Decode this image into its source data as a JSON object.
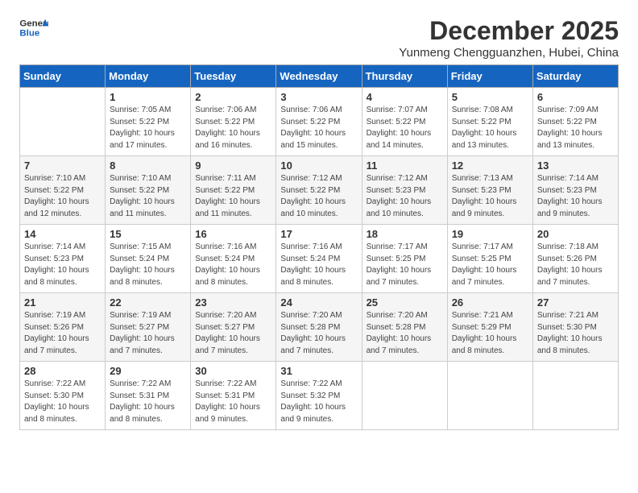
{
  "header": {
    "logo_line1": "General",
    "logo_line2": "Blue",
    "month_year": "December 2025",
    "location": "Yunmeng Chengguanzhen, Hubei, China"
  },
  "weekdays": [
    "Sunday",
    "Monday",
    "Tuesday",
    "Wednesday",
    "Thursday",
    "Friday",
    "Saturday"
  ],
  "weeks": [
    [
      {
        "day": "",
        "info": ""
      },
      {
        "day": "1",
        "info": "Sunrise: 7:05 AM\nSunset: 5:22 PM\nDaylight: 10 hours\nand 17 minutes."
      },
      {
        "day": "2",
        "info": "Sunrise: 7:06 AM\nSunset: 5:22 PM\nDaylight: 10 hours\nand 16 minutes."
      },
      {
        "day": "3",
        "info": "Sunrise: 7:06 AM\nSunset: 5:22 PM\nDaylight: 10 hours\nand 15 minutes."
      },
      {
        "day": "4",
        "info": "Sunrise: 7:07 AM\nSunset: 5:22 PM\nDaylight: 10 hours\nand 14 minutes."
      },
      {
        "day": "5",
        "info": "Sunrise: 7:08 AM\nSunset: 5:22 PM\nDaylight: 10 hours\nand 13 minutes."
      },
      {
        "day": "6",
        "info": "Sunrise: 7:09 AM\nSunset: 5:22 PM\nDaylight: 10 hours\nand 13 minutes."
      }
    ],
    [
      {
        "day": "7",
        "info": "Sunrise: 7:10 AM\nSunset: 5:22 PM\nDaylight: 10 hours\nand 12 minutes."
      },
      {
        "day": "8",
        "info": "Sunrise: 7:10 AM\nSunset: 5:22 PM\nDaylight: 10 hours\nand 11 minutes."
      },
      {
        "day": "9",
        "info": "Sunrise: 7:11 AM\nSunset: 5:22 PM\nDaylight: 10 hours\nand 11 minutes."
      },
      {
        "day": "10",
        "info": "Sunrise: 7:12 AM\nSunset: 5:22 PM\nDaylight: 10 hours\nand 10 minutes."
      },
      {
        "day": "11",
        "info": "Sunrise: 7:12 AM\nSunset: 5:23 PM\nDaylight: 10 hours\nand 10 minutes."
      },
      {
        "day": "12",
        "info": "Sunrise: 7:13 AM\nSunset: 5:23 PM\nDaylight: 10 hours\nand 9 minutes."
      },
      {
        "day": "13",
        "info": "Sunrise: 7:14 AM\nSunset: 5:23 PM\nDaylight: 10 hours\nand 9 minutes."
      }
    ],
    [
      {
        "day": "14",
        "info": "Sunrise: 7:14 AM\nSunset: 5:23 PM\nDaylight: 10 hours\nand 8 minutes."
      },
      {
        "day": "15",
        "info": "Sunrise: 7:15 AM\nSunset: 5:24 PM\nDaylight: 10 hours\nand 8 minutes."
      },
      {
        "day": "16",
        "info": "Sunrise: 7:16 AM\nSunset: 5:24 PM\nDaylight: 10 hours\nand 8 minutes."
      },
      {
        "day": "17",
        "info": "Sunrise: 7:16 AM\nSunset: 5:24 PM\nDaylight: 10 hours\nand 8 minutes."
      },
      {
        "day": "18",
        "info": "Sunrise: 7:17 AM\nSunset: 5:25 PM\nDaylight: 10 hours\nand 7 minutes."
      },
      {
        "day": "19",
        "info": "Sunrise: 7:17 AM\nSunset: 5:25 PM\nDaylight: 10 hours\nand 7 minutes."
      },
      {
        "day": "20",
        "info": "Sunrise: 7:18 AM\nSunset: 5:26 PM\nDaylight: 10 hours\nand 7 minutes."
      }
    ],
    [
      {
        "day": "21",
        "info": "Sunrise: 7:19 AM\nSunset: 5:26 PM\nDaylight: 10 hours\nand 7 minutes."
      },
      {
        "day": "22",
        "info": "Sunrise: 7:19 AM\nSunset: 5:27 PM\nDaylight: 10 hours\nand 7 minutes."
      },
      {
        "day": "23",
        "info": "Sunrise: 7:20 AM\nSunset: 5:27 PM\nDaylight: 10 hours\nand 7 minutes."
      },
      {
        "day": "24",
        "info": "Sunrise: 7:20 AM\nSunset: 5:28 PM\nDaylight: 10 hours\nand 7 minutes."
      },
      {
        "day": "25",
        "info": "Sunrise: 7:20 AM\nSunset: 5:28 PM\nDaylight: 10 hours\nand 7 minutes."
      },
      {
        "day": "26",
        "info": "Sunrise: 7:21 AM\nSunset: 5:29 PM\nDaylight: 10 hours\nand 8 minutes."
      },
      {
        "day": "27",
        "info": "Sunrise: 7:21 AM\nSunset: 5:30 PM\nDaylight: 10 hours\nand 8 minutes."
      }
    ],
    [
      {
        "day": "28",
        "info": "Sunrise: 7:22 AM\nSunset: 5:30 PM\nDaylight: 10 hours\nand 8 minutes."
      },
      {
        "day": "29",
        "info": "Sunrise: 7:22 AM\nSunset: 5:31 PM\nDaylight: 10 hours\nand 8 minutes."
      },
      {
        "day": "30",
        "info": "Sunrise: 7:22 AM\nSunset: 5:31 PM\nDaylight: 10 hours\nand 9 minutes."
      },
      {
        "day": "31",
        "info": "Sunrise: 7:22 AM\nSunset: 5:32 PM\nDaylight: 10 hours\nand 9 minutes."
      },
      {
        "day": "",
        "info": ""
      },
      {
        "day": "",
        "info": ""
      },
      {
        "day": "",
        "info": ""
      }
    ]
  ]
}
